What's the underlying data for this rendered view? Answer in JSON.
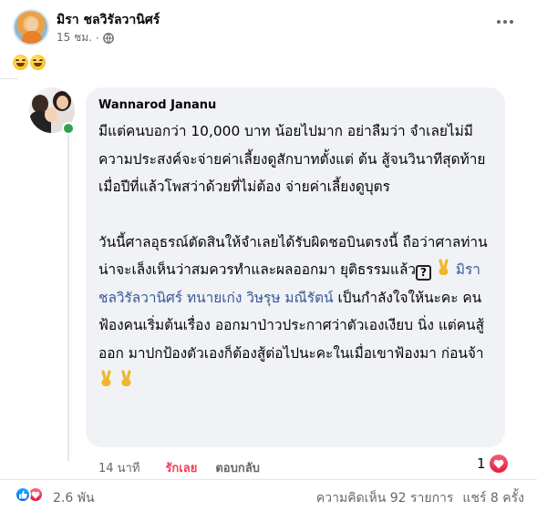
{
  "post": {
    "author": "มิรา ชลวิรัลวานิศร์",
    "time": "15 ชม.",
    "privacy_icon": "globe-icon",
    "body_emoji": [
      "grinning-face-icon",
      "grinning-face-icon"
    ]
  },
  "comment": {
    "author": "Wannarod Jananu",
    "paragraph1": "มีแต่คนบอกว่า 10,000 บาท น้อยไปมาก อย่าลืมว่า จำเลยไม่มีความประสงค์จะจ่ายค่าเลี้ยงดูสักบาทตั้งแต่ ต้น สู้จนวินาทีสุดท้าย เมื่อปีที่แล้วโพสว่าด้วยที่ไม่ต้อง จ่ายค่าเลี้ยงดูบุตร",
    "paragraph2_a": "วันนี้ศาลอุธรณ์ตัดสินให้จำเลยได้รับผิดชอบินตรงนี้ ถือว่าศาลท่านน่าจะเล็งเห็นว่าสมควรทำและผลออกมา ยุติธรรมแล้ว",
    "box_symbol": "?",
    "mention": "มิรา ชลวิรัลวานิศร์ ทนายเก่ง วิษรุษ มณีรัตน์",
    "paragraph2_b": "เป็นกำลังใจให้นะคะ คนฟ้องคนเริ่มต้นเรื่อง ออกมาป่าวประกาศว่าตัวเองเงียบ นิ่ง แต่คนสู้ออก มาปกป้องตัวเองก็ต้องสู้ต่อไปนะคะในเมื่อเขาฟ้องมา ก่อนจ้า",
    "time": "14 นาที",
    "like_label": "รักเลย",
    "reply_label": "ตอบกลับ",
    "reaction_count": "1",
    "reaction_icon": "heart-icon"
  },
  "footer": {
    "reaction_total": "2.6 พัน",
    "comments": "ความคิดเห็น 92 รายการ",
    "shares": "แชร์ 8 ครั้ง"
  },
  "colors": {
    "like_red": "#f33e58",
    "mention_blue": "#385898",
    "bubble_bg": "#f0f2f5",
    "online_green": "#31a24c"
  }
}
